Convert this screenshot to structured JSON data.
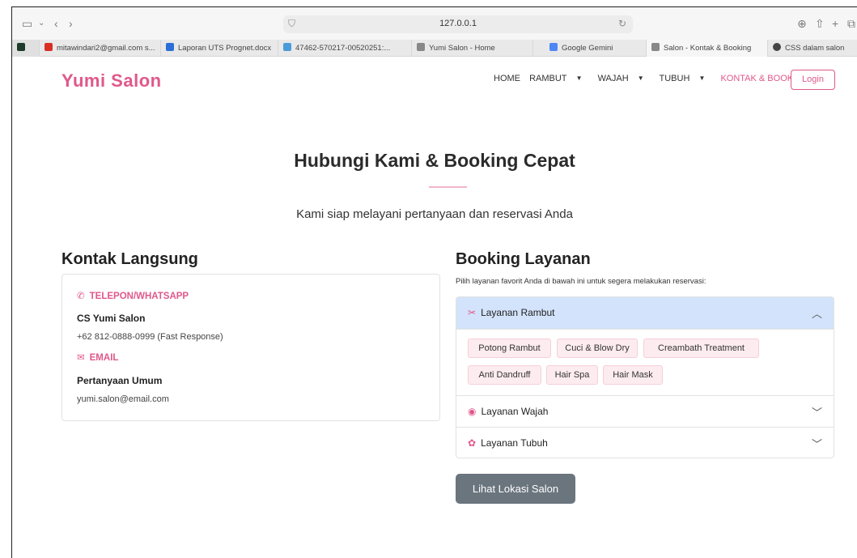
{
  "browser": {
    "url": "127.0.0.1",
    "tabs": [
      {
        "label": "mitawindari2@gmail.com s...",
        "color": "#d93025"
      },
      {
        "label": "Laporan UTS Prognet.docx",
        "color": "#2b6fd6"
      },
      {
        "label": "47462-570217-00520251:...",
        "color": "#4a9bd8"
      },
      {
        "label": "Yumi Salon - Home",
        "color": "#888888"
      },
      {
        "label": "Google Gemini",
        "color": "#4f86f7"
      },
      {
        "label": "Salon - Kontak & Booking",
        "color": "#888888"
      },
      {
        "label": "CSS dalam salon",
        "color": "#444444"
      }
    ]
  },
  "header": {
    "brand": "Yumi Salon",
    "nav": {
      "home": "HOME",
      "rambut": "RAMBUT",
      "wajah": "WAJAH",
      "tubuh": "TUBUH",
      "kontak": "KONTAK & BOOKING"
    },
    "login": "Login"
  },
  "hero": {
    "title": "Hubungi Kami & Booking Cepat",
    "subtitle": "Kami siap melayani pertanyaan dan reservasi Anda"
  },
  "contact": {
    "title": "Kontak Langsung",
    "phone_heading": "TELEPON/WHATSAPP",
    "phone_name": "CS Yumi Salon",
    "phone_number": "+62 812-0888-0999 (Fast Response)",
    "email_heading": "EMAIL",
    "email_name": "Pertanyaan Umum",
    "email_address": "yumi.salon@email.com"
  },
  "booking": {
    "title": "Booking Layanan",
    "note": "Pilih layanan favorit Anda di bawah ini untuk segera melakukan reservasi:",
    "rambut": {
      "label": "Layanan Rambut",
      "chips": [
        "Potong Rambut",
        "Cuci & Blow Dry",
        "Creambath Treatment",
        "Anti Dandruff",
        "Hair Spa",
        "Hair Mask"
      ]
    },
    "wajah": {
      "label": "Layanan Wajah"
    },
    "tubuh": {
      "label": "Layanan Tubuh"
    },
    "location_button": "Lihat Lokasi Salon"
  },
  "colors": {
    "accent": "#e0588a",
    "accordion_open": "#d3e3fb",
    "button": "#6b757e"
  }
}
